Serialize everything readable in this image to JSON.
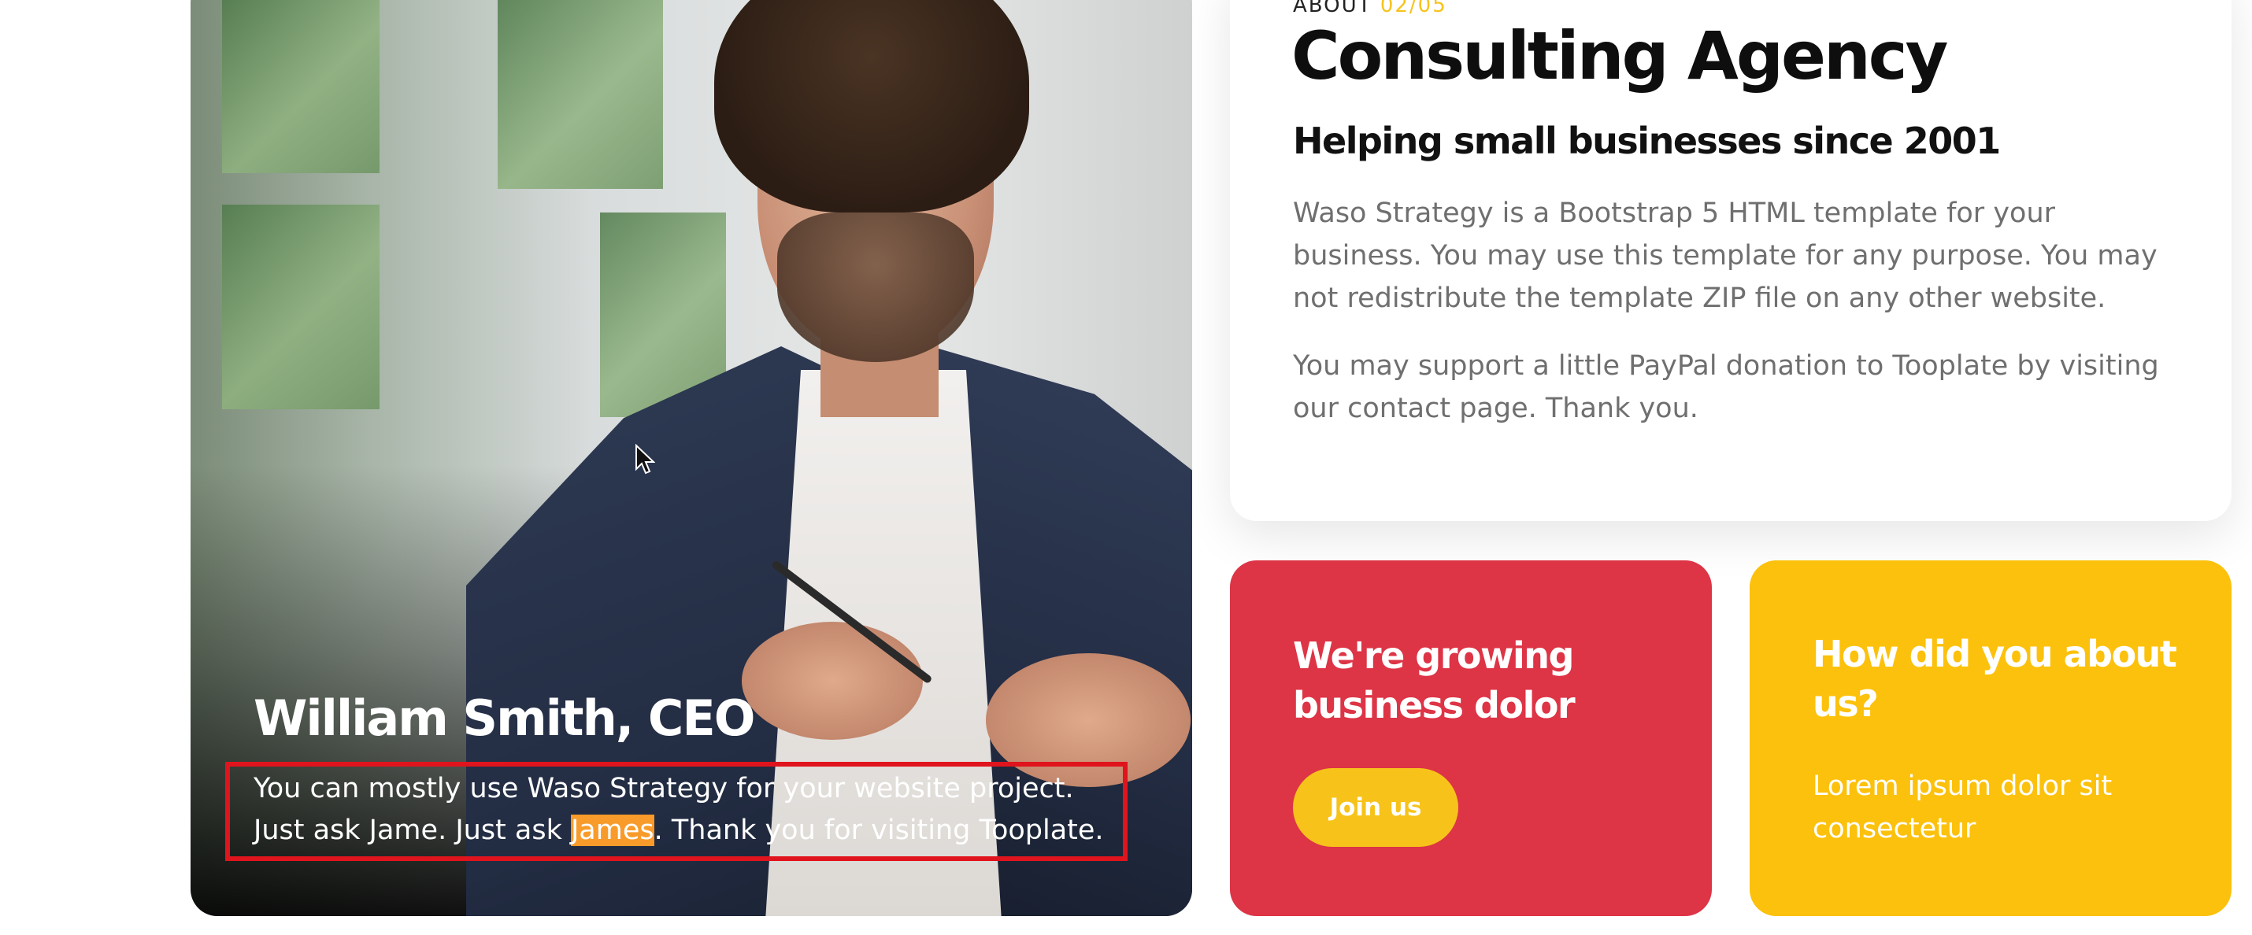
{
  "profile": {
    "name": "William Smith, CEO",
    "caption_before": "You can mostly use Waso Strategy for your website project. Just ask Jame. Just ask ",
    "caption_highlight": "James",
    "caption_after": ". Thank you for visiting Tooplate."
  },
  "about": {
    "meta_label": "ABOUT ",
    "meta_index": "02/05",
    "title": "Consulting Agency",
    "subtitle": "Helping small businesses since 2001",
    "paragraph_1": "Waso Strategy is a Bootstrap 5 HTML template for your business. You may use this template for any purpose. You may not redistribute the template ZIP file on any other website.",
    "paragraph_2": "You may support a little PayPal donation to Tooplate by visiting our contact page. Thank you."
  },
  "growing_card": {
    "title": "We're growing business dolor",
    "button_label": "Join us"
  },
  "about_us_card": {
    "title": "How did you about us?",
    "text": "Lorem ipsum dolor sit consectetur"
  },
  "colors": {
    "red_card": "#dd3446",
    "yellow_card": "#fcc10c",
    "accent_yellow": "#f7c31a",
    "highlight": "#f89b2a",
    "annotation_box": "#e0141d"
  },
  "icons": {
    "cursor": "mouse-pointer-icon"
  }
}
